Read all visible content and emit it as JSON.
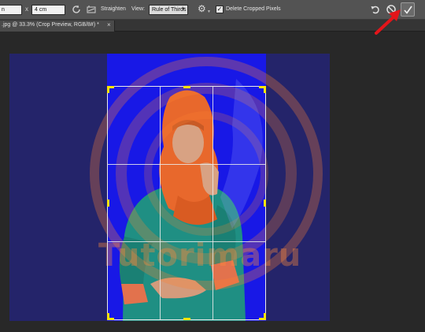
{
  "options_bar": {
    "width_value": "n",
    "height_value": "4 cm",
    "swap_symbol": "x",
    "straighten_label": "Straighten",
    "view_label": "View:",
    "view_value": "Rule of Thirds",
    "delete_cropped_label": "Delete Cropped Pixels",
    "delete_cropped_checked": true
  },
  "document_tab": {
    "title": ".jpg @ 33.3% (Crop Preview, RGB/8#) *",
    "close_symbol": "×"
  },
  "watermark": {
    "text": "Tutorimaru"
  },
  "colors": {
    "crop_background": "#1818e6",
    "shield_background": "#24246a",
    "handle": "#ffe500",
    "arrow": "#e3151a"
  }
}
